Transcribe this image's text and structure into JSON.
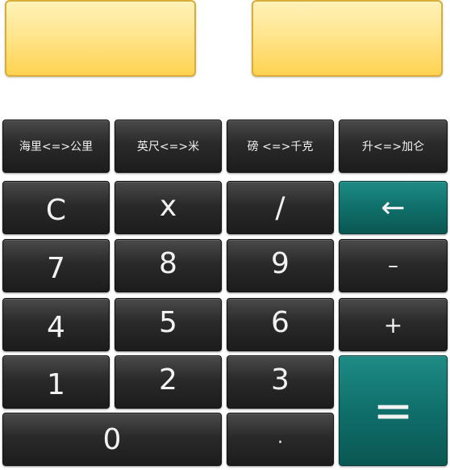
{
  "displays": {
    "left": "",
    "right": ""
  },
  "conversions": [
    {
      "label": "海里<=>公里"
    },
    {
      "label": "英尺<=>米"
    },
    {
      "label": "磅 <=>千克"
    },
    {
      "label": "升<=>加仑"
    }
  ],
  "keys": {
    "clear": "C",
    "multiply": "x",
    "divide": "/",
    "backspace": "←",
    "seven": "7",
    "eight": "8",
    "nine": "9",
    "minus": "–",
    "four": "4",
    "five": "5",
    "six": "6",
    "plus": "+",
    "one": "1",
    "two": "2",
    "three": "3",
    "equals": "=",
    "zero": "0",
    "decimal": "·"
  },
  "colors": {
    "display_gradient_top": "#fff2b8",
    "display_gradient_bottom": "#ffd350",
    "key_dark": "#2a2a2a",
    "key_accent_teal": "#0f6f6a"
  }
}
